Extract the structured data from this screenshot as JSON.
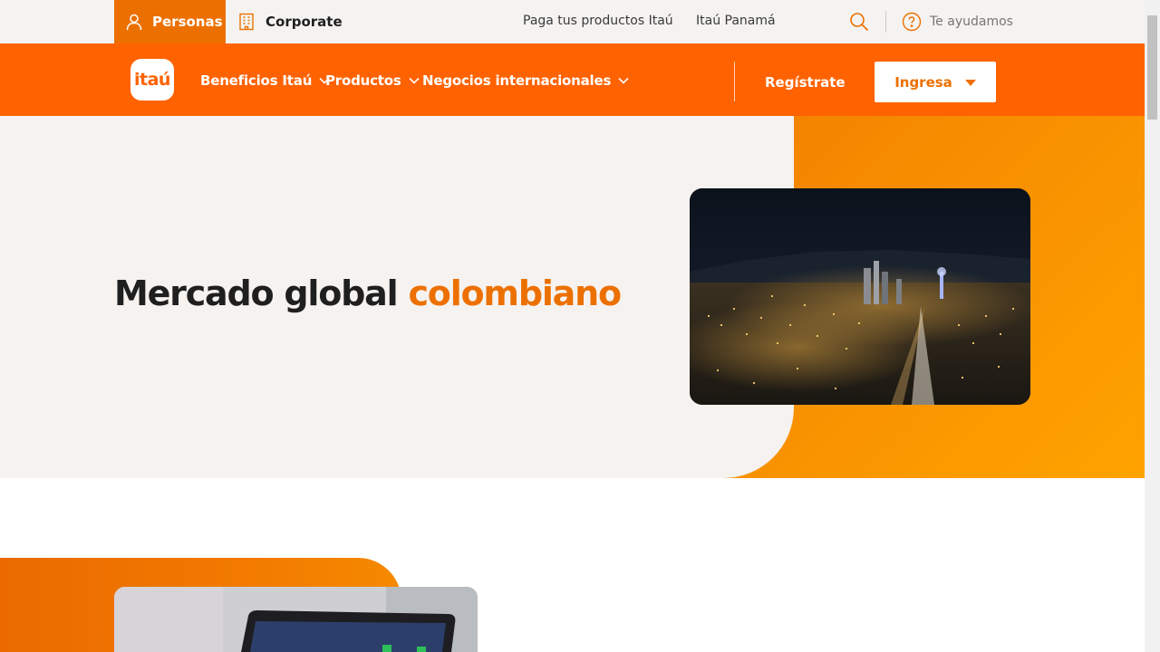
{
  "topbar": {
    "segments": [
      {
        "label": "Personas",
        "icon": "person-icon",
        "active": true
      },
      {
        "label": "Corporate",
        "icon": "building-icon",
        "active": false
      }
    ],
    "links": [
      "Paga tus productos Itaú",
      "Itaú Panamá"
    ],
    "search_icon": "search-icon",
    "help": {
      "label": "Te ayudamos",
      "icon": "help-circle-icon"
    }
  },
  "nav": {
    "logo_text": "itaú",
    "items": [
      {
        "label": "Beneficios Itaú"
      },
      {
        "label": "Productos"
      },
      {
        "label": "Negocios internacionales"
      }
    ],
    "register_label": "Regístrate",
    "login_label": "Ingresa"
  },
  "hero": {
    "title_main": "Mercado global",
    "title_accent": "colombiano"
  },
  "colors": {
    "brand_orange": "#ff6200",
    "accent_orange": "#ec7000",
    "cream": "#f5f2ef"
  }
}
